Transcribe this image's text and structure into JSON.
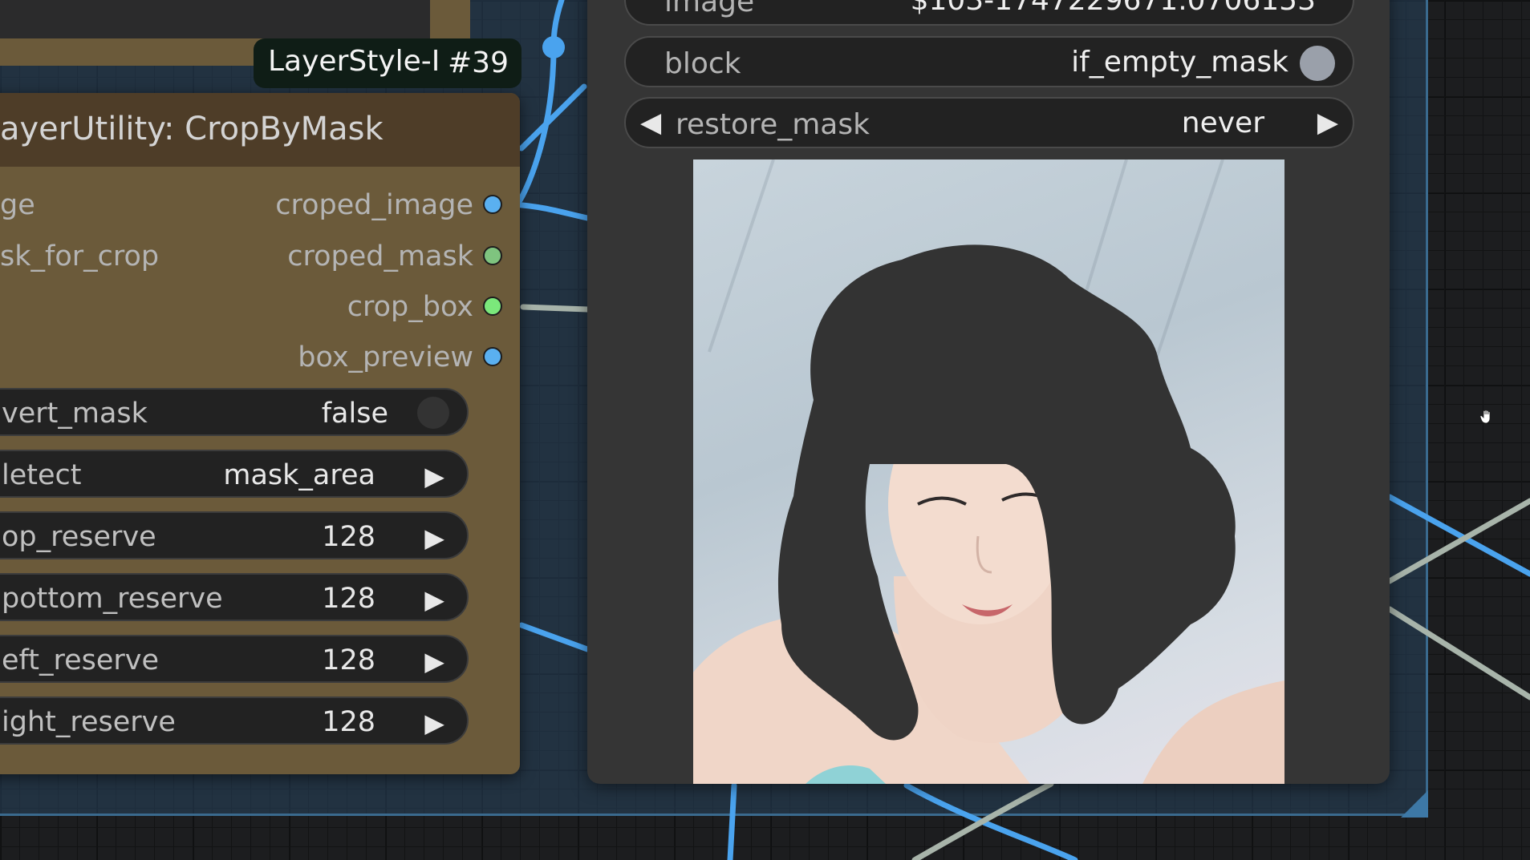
{
  "tooltip": {
    "title": "LayerStyle-I",
    "id": "#39"
  },
  "crop_node": {
    "title": "ayerUtility: CropByMask",
    "inputs": [
      "ge",
      "sk_for_crop"
    ],
    "outputs": [
      {
        "label": "croped_image",
        "color": "#5ab0f0"
      },
      {
        "label": "croped_mask",
        "color": "#7fc47f"
      },
      {
        "label": "crop_box",
        "color": "#7be87b"
      },
      {
        "label": "box_preview",
        "color": "#5ab0f0"
      }
    ],
    "widgets": [
      {
        "label": "vert_mask",
        "value": "false"
      },
      {
        "label": "letect",
        "value": "mask_area"
      },
      {
        "label": "op_reserve",
        "value": "128"
      },
      {
        "label": "pottom_reserve",
        "value": "128"
      },
      {
        "label": "eft_reserve",
        "value": "128"
      },
      {
        "label": "ight_reserve",
        "value": "128"
      }
    ],
    "arrow_glyph": "▶"
  },
  "right_node": {
    "image_row": {
      "label": "image",
      "value": "$103-1747229671.0706153"
    },
    "block_row": {
      "label": "block",
      "value": "if_empty_mask"
    },
    "restore_row": {
      "label": "restore_mask",
      "value": "never",
      "left_arrow": "◀",
      "right_arrow": "▶"
    }
  },
  "colors": {
    "node_body": "#6b5a3a",
    "node_header": "#4e3d28",
    "group_border": "#3a6a8e",
    "wire_blue": "#4aa3ee",
    "wire_gray": "#a8b4aa"
  }
}
